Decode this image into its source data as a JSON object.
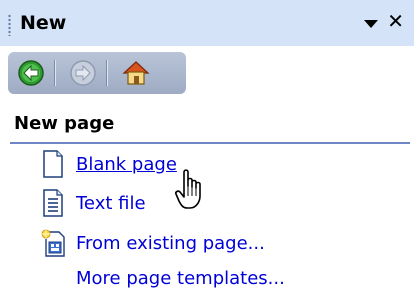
{
  "pane": {
    "title": "New"
  },
  "section": {
    "title": "New page"
  },
  "items": [
    {
      "label": "Blank page",
      "icon": "blank-page-icon"
    },
    {
      "label": "Text file",
      "icon": "text-file-icon"
    },
    {
      "label": "From existing page...",
      "icon": "existing-page-icon"
    },
    {
      "label": "More page templates..."
    }
  ],
  "colors": {
    "titlebar": "#d4e3f8",
    "link": "#0000d8",
    "rule": "#6f87c6"
  }
}
